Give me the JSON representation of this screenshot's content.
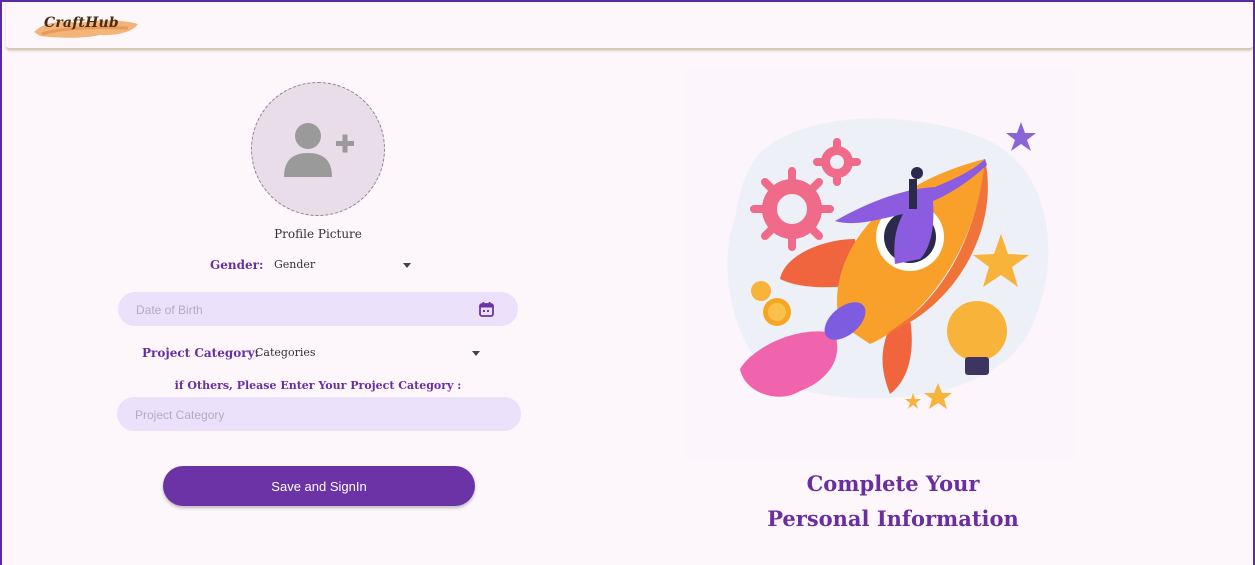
{
  "app": {
    "logo_text": "CraftHub"
  },
  "form": {
    "profile_picture_label": "Profile Picture",
    "gender": {
      "label": "Gender:",
      "value": "Gender"
    },
    "date_of_birth": {
      "placeholder": "Date of Birth"
    },
    "project_category": {
      "label": "Project Category:",
      "value": "Categories"
    },
    "others_label": "if Others, Please Enter Your Project Category :",
    "project_category_input": {
      "placeholder": "Project Category"
    },
    "save_button": "Save and SignIn"
  },
  "illustration": {
    "headline_line1": "Complete Your",
    "headline_line2": "Personal Information"
  },
  "icons": {
    "avatar": "add-person-icon",
    "calendar": "calendar-icon",
    "dropdown": "caret-down-icon"
  },
  "colors": {
    "accent": "#6b33a6",
    "field_bg": "#ebe1fa",
    "page_bg": "#fdf7fb"
  }
}
